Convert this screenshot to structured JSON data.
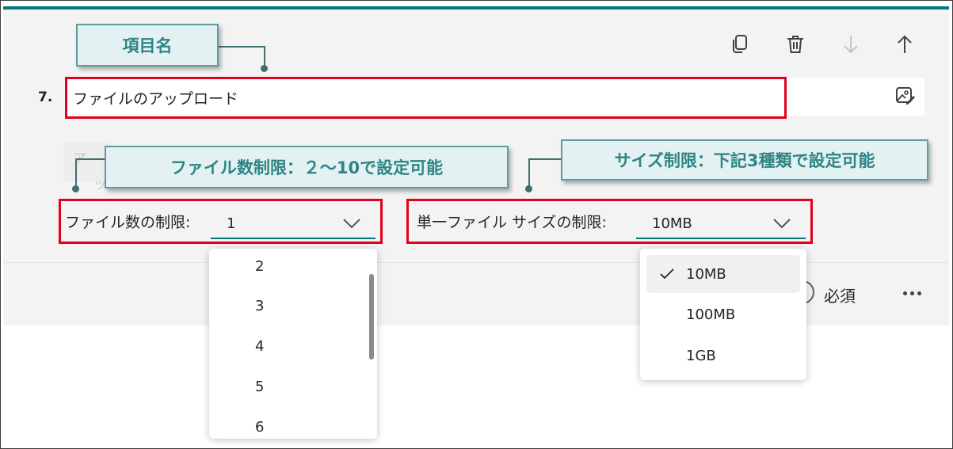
{
  "question": {
    "number": "7.",
    "title": "ファイルのアップロード",
    "faded_hint_char_1": "ア",
    "faded_hint_char_2": "ッ"
  },
  "toolbar": {
    "copy": "copy-icon",
    "delete": "trash-icon",
    "move_down": "arrow-down-icon",
    "move_up": "arrow-up-icon",
    "image": "image-edit-icon"
  },
  "file_count": {
    "label": "ファイル数の制限:",
    "value": "1",
    "options": [
      "2",
      "3",
      "4",
      "5",
      "6"
    ]
  },
  "file_size": {
    "label": "単一ファイル サイズの制限:",
    "value": "10MB",
    "options": [
      "10MB",
      "100MB",
      "1GB"
    ],
    "selected": "10MB"
  },
  "footer": {
    "required_label": "必須"
  },
  "callouts": {
    "item_name": "項目名",
    "file_count": "ファイル数制限：２～10で設定可能",
    "size": "サイズ制限：下記3種類で設定可能"
  },
  "colors": {
    "accent": "#03787c",
    "annotation_red": "#e2001a",
    "callout_text": "#2f8585",
    "callout_bg": "#e3f1f2"
  }
}
